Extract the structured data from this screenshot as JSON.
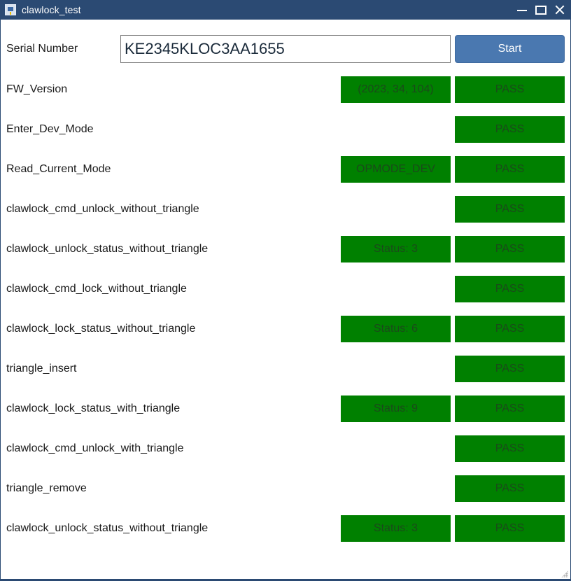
{
  "window": {
    "title": "clawlock_test"
  },
  "serial": {
    "label": "Serial Number",
    "value": "KE2345KLOC3AA1655",
    "start_label": "Start"
  },
  "colors": {
    "titlebar": "#2b4a73",
    "pass_green": "#008000",
    "start_button": "#4a78b0"
  },
  "tests": [
    {
      "name": "FW_Version",
      "value": "(2023, 34, 104)",
      "result": "PASS"
    },
    {
      "name": "Enter_Dev_Mode",
      "value": "",
      "result": "PASS"
    },
    {
      "name": "Read_Current_Mode",
      "value": "OPMODE_DEV",
      "result": "PASS"
    },
    {
      "name": "clawlock_cmd_unlock_without_triangle",
      "value": "",
      "result": "PASS"
    },
    {
      "name": "clawlock_unlock_status_without_triangle",
      "value": "Status: 3",
      "result": "PASS"
    },
    {
      "name": "clawlock_cmd_lock_without_triangle",
      "value": "",
      "result": "PASS"
    },
    {
      "name": "clawlock_lock_status_without_triangle",
      "value": "Status: 6",
      "result": "PASS"
    },
    {
      "name": "triangle_insert",
      "value": "",
      "result": "PASS"
    },
    {
      "name": "clawlock_lock_status_with_triangle",
      "value": "Status: 9",
      "result": "PASS"
    },
    {
      "name": "clawlock_cmd_unlock_with_triangle",
      "value": "",
      "result": "PASS"
    },
    {
      "name": "triangle_remove",
      "value": "",
      "result": "PASS"
    },
    {
      "name": "clawlock_unlock_status_without_triangle",
      "value": "Status: 3",
      "result": "PASS"
    }
  ]
}
